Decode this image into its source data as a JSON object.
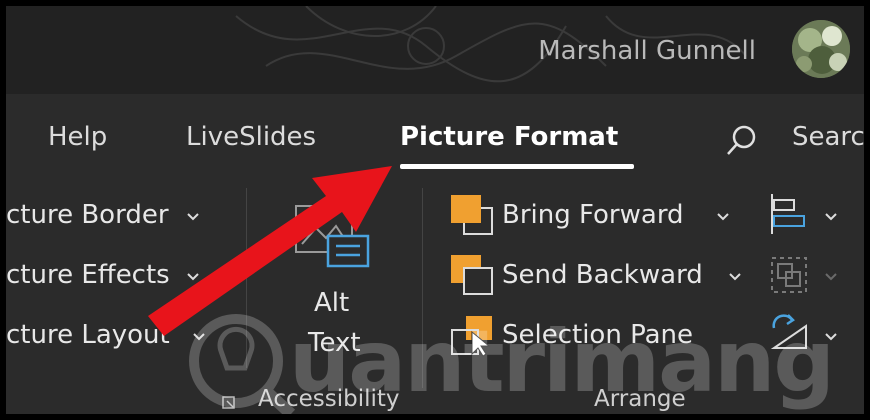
{
  "titlebar": {
    "user_name": "Marshall Gunnell"
  },
  "tabs": {
    "help": "Help",
    "liveslides": "LiveSlides",
    "picture_format": "Picture Format",
    "search": "Search"
  },
  "ribbon": {
    "picture_styles": {
      "border": "cture Border",
      "effects": "cture Effects",
      "layout": "cture Layout"
    },
    "accessibility": {
      "alt_text_line1": "Alt",
      "alt_text_line2": "Text",
      "group_label": "Accessibility"
    },
    "arrange": {
      "bring_forward": "Bring Forward",
      "send_backward": "Send Backward",
      "selection_pane": "Selection Pane",
      "group_label": "Arrange"
    }
  },
  "watermark": {
    "text": "uantrimang"
  },
  "colors": {
    "accent_orange": "#f0a030",
    "annotation_red": "#e8141b",
    "ribbon_bg": "#2b2b2b",
    "titlebar_bg": "#222222"
  }
}
